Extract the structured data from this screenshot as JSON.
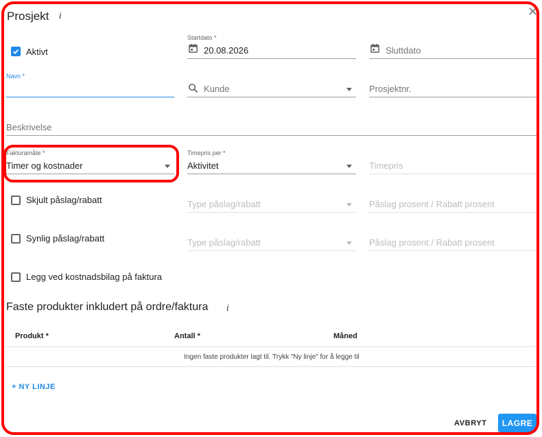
{
  "dialog": {
    "title": "Prosjekt",
    "info_glyph": "i",
    "close_glyph": "✕"
  },
  "fields": {
    "aktivt": {
      "label": "Aktivt",
      "checked": true
    },
    "startdato": {
      "label": "Startdato *",
      "value": "20.08.2026",
      "icon": "calendar-icon"
    },
    "sluttdato": {
      "placeholder": "Sluttdato",
      "icon": "calendar-icon"
    },
    "navn": {
      "label": "Navn *",
      "value": ""
    },
    "kunde": {
      "placeholder": "Kunde",
      "icon": "search-icon"
    },
    "prosjektnr": {
      "placeholder": "Prosjektnr."
    },
    "beskrivelse": {
      "placeholder": "Beskrivelse"
    },
    "fakturamate": {
      "label": "Fakturamåte *",
      "value": "Timer og kostnader"
    },
    "timepris_per": {
      "label": "Timepris per *",
      "value": "Aktivitet"
    },
    "timepris": {
      "placeholder": "Timepris"
    },
    "skjult": {
      "label": "Skjult påslag/rabatt",
      "type_placeholder": "Type påslag/rabatt",
      "prosent_placeholder": "Påslag prosent / Rabatt prosent"
    },
    "synlig": {
      "label": "Synlig påslag/rabatt",
      "type_placeholder": "Type påslag/rabatt",
      "prosent_placeholder": "Påslag prosent / Rabatt prosent"
    },
    "legg_ved": {
      "label": "Legg ved kostnadsbilag på faktura"
    }
  },
  "products": {
    "title": "Faste produkter inkludert på ordre/faktura",
    "columns": [
      "Produkt *",
      "Antall *",
      "Måned"
    ],
    "empty_message": "Ingen faste produkter lagt til. Trykk \"Ny linje\" for å legge til",
    "add_label": "+ NY LINJE"
  },
  "footer": {
    "cancel_label": "AVBRYT",
    "save_label": "LAGRE"
  },
  "colors": {
    "accent": "#2196f3",
    "highlight": "#ff0000"
  }
}
